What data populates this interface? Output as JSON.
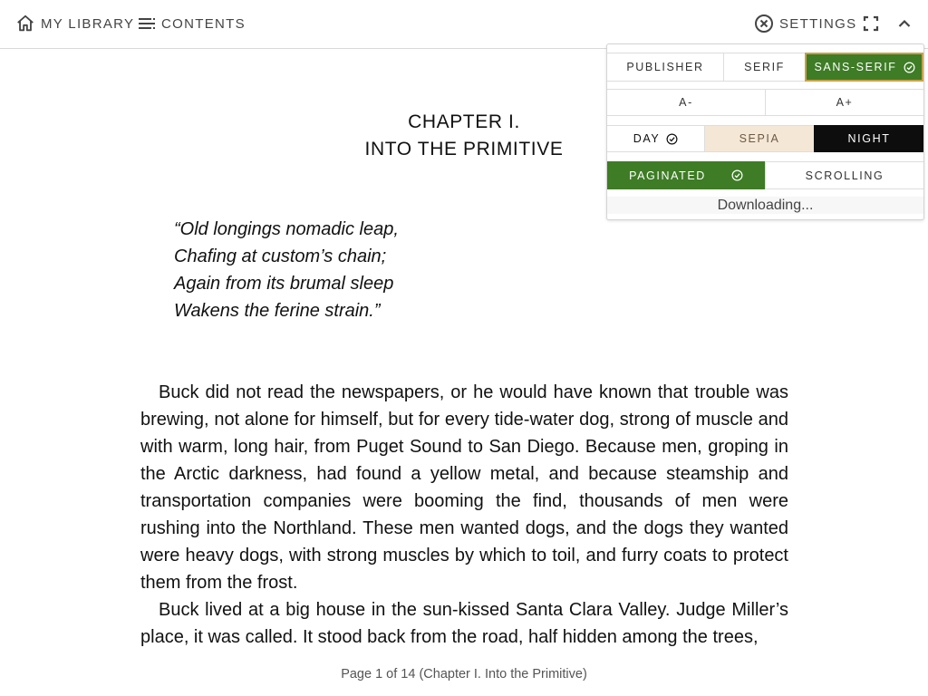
{
  "topbar": {
    "library_label": "MY LIBRARY",
    "contents_label": "CONTENTS",
    "settings_label": "SETTINGS",
    "icons": {
      "library": "home-icon",
      "contents": "list-icon",
      "settings": "close-circle-icon",
      "fullscreen": "fullscreen-icon",
      "collapse": "chevron-up-icon"
    }
  },
  "settings": {
    "fonts": [
      "PUBLISHER",
      "SERIF",
      "SANS-SERIF"
    ],
    "selected_font": "SANS-SERIF",
    "size_decrease": "A-",
    "size_increase": "A+",
    "themes": [
      "DAY",
      "SEPIA",
      "NIGHT"
    ],
    "selected_theme": "DAY",
    "modes": [
      "PAGINATED",
      "SCROLLING"
    ],
    "selected_mode": "PAGINATED",
    "status": "Downloading...",
    "colors": {
      "accent_green": "#3e7c25",
      "sepia_bg": "#f5e7d6",
      "night_bg": "#0d0d0d",
      "focus_ring": "#c9a14a"
    }
  },
  "content": {
    "chapter_number": "CHAPTER I.",
    "chapter_title": "INTO THE PRIMITIVE",
    "epigraph": [
      "“Old longings nomadic leap,",
      "Chafing at custom’s chain;",
      "Again from its brumal sleep",
      "Wakens the ferine strain.”"
    ],
    "paragraphs": [
      "Buck did not read the newspapers, or he would have known that trouble was brewing, not alone for himself, but for every tide-water dog, strong of muscle and with warm, long hair, from Puget Sound to San Diego. Because men, groping in the Arctic darkness, had found a yellow metal, and because steamship and transportation companies were booming the find, thousands of men were rushing into the Northland. These men wanted dogs, and the dogs they wanted were heavy dogs, with strong muscles by which to toil, and furry coats to protect them from the frost.",
      "Buck lived at a big house in the sun-kissed Santa Clara Valley. Judge Miller’s place, it was called. It stood back from the road, half hidden among the trees,"
    ]
  },
  "footer": {
    "page_status": "Page 1 of 14 (Chapter I. Into the Primitive)"
  }
}
